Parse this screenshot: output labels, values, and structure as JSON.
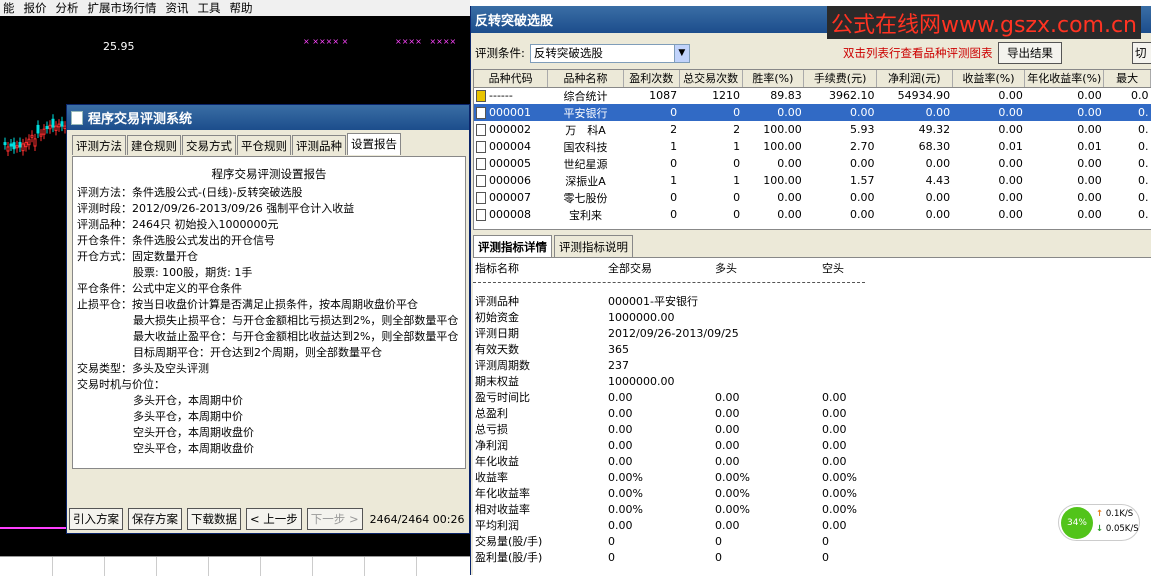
{
  "menu": [
    "能",
    "报价",
    "分析",
    "扩展市场行情",
    "资讯",
    "工具",
    "帮助"
  ],
  "chart": {
    "price_label": "25.95"
  },
  "left_dialog": {
    "title": "程序交易评测系统",
    "tabs": [
      "评测方法",
      "建仓规则",
      "交易方式",
      "平仓规则",
      "评测品种",
      "设置报告"
    ],
    "active_tab": 5,
    "report_title": "程序交易评测设置报告",
    "report_lines": [
      "评测方法：条件选股公式-(日线)-反转突破选股",
      "评测时段：2012/09/26-2013/09/26 强制平仓计入收益",
      "评测品种：2464只 初始投入1000000元",
      "开仓条件：条件选股公式发出的开仓信号",
      "开仓方式：固定数量开仓",
      "                股票: 100股，期货: 1手",
      "平仓条件：公式中定义的平仓条件",
      "止损平仓：按当日收盘价计算是否满足止损条件，按本周期收盘价平仓",
      "                最大损失止损平仓：与开仓金额相比亏损达到2%，则全部数量平仓",
      "                最大收益止盈平仓：与开仓金额相比收益达到2%，则全部数量平仓",
      "                目标周期平仓：开仓达到2个周期，则全部数量平仓",
      "",
      "交易类型：多头及空头评测",
      "交易时机与价位：",
      "                多头开仓，本周期中价",
      "                多头平仓，本周期中价",
      "                空头开仓，本周期收盘价",
      "                空头平仓，本周期收盘价"
    ],
    "buttons": {
      "import": "引入方案",
      "save": "保存方案",
      "download": "下载数据",
      "prev": "< 上一步",
      "next": "下一步 >"
    },
    "status": "2464/2464 00:26"
  },
  "right_dialog": {
    "title": "反转突破选股",
    "watermark": "公式在线网www.gszx.com.cn",
    "criteria_label": "评测条件:",
    "criteria_value": "反转突破选股",
    "hint": "双击列表行查看品种评测图表",
    "export_button": "导出结果",
    "cut_button": "切",
    "columns": [
      "品种代码",
      "品种名称",
      "盈利次数",
      "总交易次数",
      "胜率(%)",
      "手续费(元)",
      "净利润(元)",
      "收益率(%)",
      "年化收益率(%)",
      "最大"
    ],
    "rows": [
      [
        "------",
        "综合统计",
        "1087",
        "1210",
        "89.83",
        "3962.10",
        "54934.90",
        "0.00",
        "0.00",
        "0.0"
      ],
      [
        "000001",
        "平安银行",
        "0",
        "0",
        "0.00",
        "0.00",
        "0.00",
        "0.00",
        "0.00",
        "0."
      ],
      [
        "000002",
        "万　科A",
        "2",
        "2",
        "100.00",
        "5.93",
        "49.32",
        "0.00",
        "0.00",
        "0."
      ],
      [
        "000004",
        "国农科技",
        "1",
        "1",
        "100.00",
        "2.70",
        "68.30",
        "0.01",
        "0.01",
        "0."
      ],
      [
        "000005",
        "世纪星源",
        "0",
        "0",
        "0.00",
        "0.00",
        "0.00",
        "0.00",
        "0.00",
        "0."
      ],
      [
        "000006",
        "深振业A",
        "1",
        "1",
        "100.00",
        "1.57",
        "4.43",
        "0.00",
        "0.00",
        "0."
      ],
      [
        "000007",
        "零七股份",
        "0",
        "0",
        "0.00",
        "0.00",
        "0.00",
        "0.00",
        "0.00",
        "0."
      ],
      [
        "000008",
        "宝利来",
        "0",
        "0",
        "0.00",
        "0.00",
        "0.00",
        "0.00",
        "0.00",
        "0."
      ]
    ],
    "selected_row": 1,
    "detail_tabs": [
      "评测指标详情",
      "评测指标说明"
    ],
    "detail_header": [
      "指标名称",
      "全部交易",
      "多头",
      "空头"
    ],
    "detail_rows": [
      [
        "评测品种",
        "000001-平安银行",
        "",
        ""
      ],
      [
        "初始资金",
        "1000000.00",
        "",
        ""
      ],
      [
        "评测日期",
        "2012/09/26-2013/09/25",
        "",
        ""
      ],
      [
        "有效天数",
        "365",
        "",
        ""
      ],
      [
        "评测周期数",
        "237",
        "",
        ""
      ],
      [
        "期末权益",
        "1000000.00",
        "",
        ""
      ],
      [
        "盈亏时间比",
        "0.00",
        "0.00",
        "0.00"
      ],
      [
        "总盈利",
        "0.00",
        "0.00",
        "0.00"
      ],
      [
        "总亏损",
        "0.00",
        "0.00",
        "0.00"
      ],
      [
        "净利润",
        "0.00",
        "0.00",
        "0.00"
      ],
      [
        "年化收益",
        "0.00",
        "0.00",
        "0.00"
      ],
      [
        "收益率",
        "0.00%",
        "0.00%",
        "0.00%"
      ],
      [
        "年化收益率",
        "0.00%",
        "0.00%",
        "0.00%"
      ],
      [
        "相对收益率",
        "0.00%",
        "0.00%",
        "0.00%"
      ],
      [
        "平均利润",
        "0.00",
        "0.00",
        "0.00"
      ],
      [
        "交易量(股/手)",
        "0",
        "0",
        "0"
      ],
      [
        "盈利量(股/手)",
        "0",
        "0",
        "0"
      ]
    ]
  },
  "network": {
    "percent": "34%",
    "up": "0.1K/S",
    "down": "0.05K/S"
  }
}
